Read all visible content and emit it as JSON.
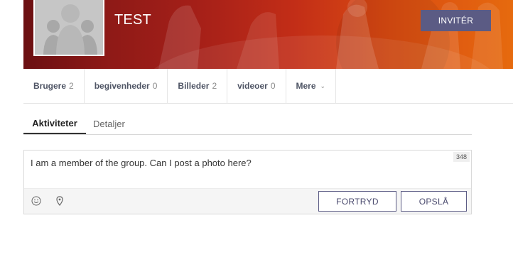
{
  "header": {
    "group_name": "TEST",
    "invite_label": "INVITÉR"
  },
  "nav": {
    "items": [
      {
        "label": "Brugere",
        "count": "2"
      },
      {
        "label": "begivenheder",
        "count": "0"
      },
      {
        "label": "Billeder",
        "count": "2"
      },
      {
        "label": "videoer",
        "count": "0"
      },
      {
        "label": "Mere",
        "count": ""
      }
    ]
  },
  "subtabs": {
    "activities": "Aktiviteter",
    "details": "Detaljer"
  },
  "composer": {
    "text": "I am a member of the group. Can I post a photo here?",
    "char_count": "348",
    "cancel_label": "FORTRYD",
    "post_label": "OPSLÅ"
  },
  "colors": {
    "accent": "#5b5b84",
    "cover_dark": "#6b0f12",
    "cover_light": "#e66a0e"
  }
}
